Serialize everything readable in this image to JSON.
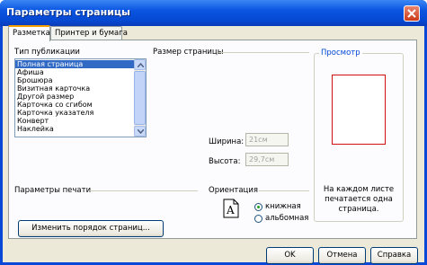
{
  "window": {
    "title": "Параметры страницы"
  },
  "tabs": [
    {
      "label": "Разметка",
      "active": true
    },
    {
      "label": "Принтер и бумага",
      "active": false
    }
  ],
  "publication": {
    "label": "Тип публикации",
    "items": [
      "Полная страница",
      "Афиша",
      "Брошюра",
      "Визитная карточка",
      "Другой размер",
      "Карточка со сгибом",
      "Карточка указателя",
      "Конверт",
      "Наклейка"
    ],
    "selected": "Полная страница"
  },
  "page_size": {
    "label": "Размер страницы",
    "width_label": "Ширина:",
    "width_value": "21см",
    "height_label": "Высота:",
    "height_value": "29,7см"
  },
  "print_params": {
    "label": "Параметры печати"
  },
  "orientation": {
    "label": "Ориентация",
    "portrait": "книжная",
    "landscape": "альбомная",
    "selected": "книжная",
    "icon_letter": "A"
  },
  "preview": {
    "label": "Просмотр",
    "text": "На каждом листе печатается одна страница."
  },
  "buttons": {
    "reorder": "Изменить порядок страниц...",
    "ok": "OK",
    "cancel": "Отмена",
    "help": "Справка"
  },
  "colors": {
    "title_bar": "#0a55e0",
    "selection": "#316ac5",
    "preview_label": "#0046d5",
    "page_border": "#d01010"
  }
}
